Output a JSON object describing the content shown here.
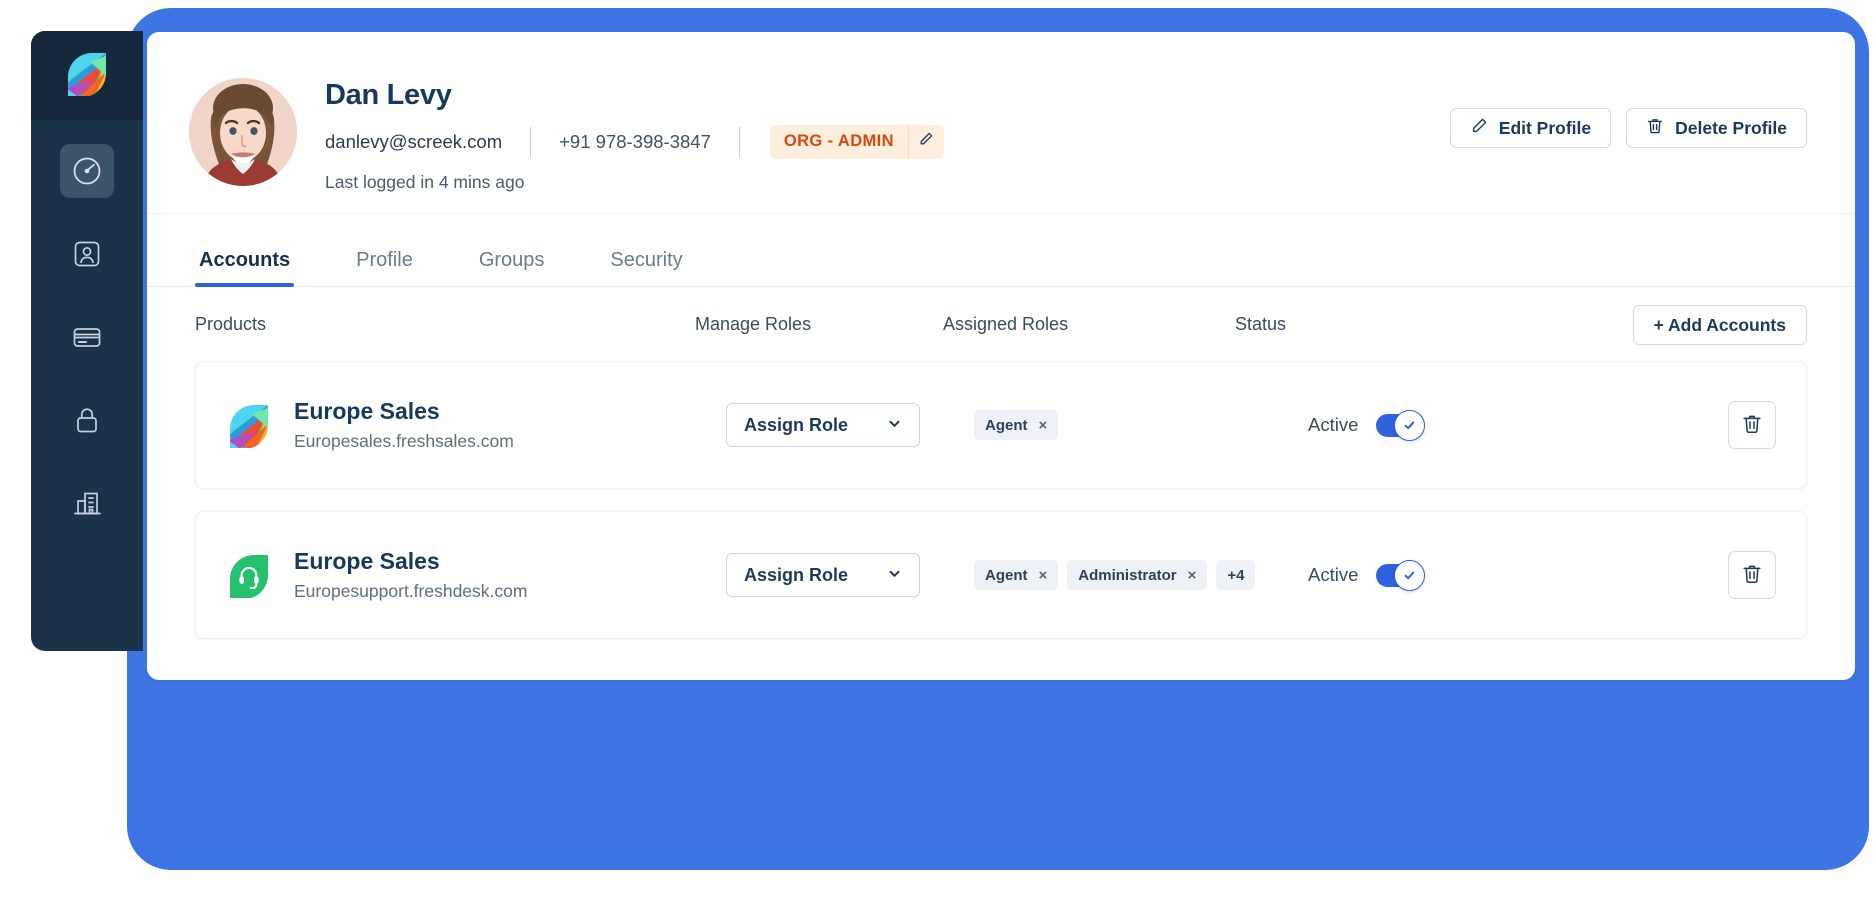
{
  "theme": {
    "frame_blue": "#3d76e4",
    "sidebar_navy": "#1b3349",
    "accent_blue": "#2f62dd",
    "badge_orange_text": "#d9480f",
    "badge_orange_bg": "#fdeedd",
    "heading_navy": "#16395c"
  },
  "sidebar": {
    "logo_icon": "freshworks-leaf-logo",
    "items": [
      {
        "icon": "gauge-dashboard-icon",
        "name": "dashboard",
        "active": true
      },
      {
        "icon": "user-card-icon",
        "name": "contacts",
        "active": false
      },
      {
        "icon": "credit-card-icon",
        "name": "billing",
        "active": false
      },
      {
        "icon": "lock-icon",
        "name": "security",
        "active": false
      },
      {
        "icon": "building-icon",
        "name": "organization",
        "active": false
      }
    ]
  },
  "profile": {
    "avatar_alt": "Dan Levy profile photo",
    "name": "Dan Levy",
    "email": "danlevy@screek.com",
    "phone": "+91 978-398-3847",
    "role_badge": "ORG - ADMIN",
    "role_badge_edit_icon": "pencil-icon",
    "last_login": "Last logged in 4 mins ago",
    "actions": [
      {
        "label": "Edit Profile",
        "icon": "pencil-icon"
      },
      {
        "label": "Delete Profile",
        "icon": "trash-icon"
      }
    ]
  },
  "tabs": [
    {
      "label": "Accounts",
      "active": true
    },
    {
      "label": "Profile",
      "active": false
    },
    {
      "label": "Groups",
      "active": false
    },
    {
      "label": "Security",
      "active": false
    }
  ],
  "table": {
    "headers": {
      "products": "Products",
      "manage_roles": "Manage Roles",
      "assigned_roles": "Assigned Roles",
      "status": "Status"
    },
    "add_accounts_label": "+ Add Accounts",
    "rows": [
      {
        "logo_icon": "freshsales-leaf-logo",
        "product_name": "Europe Sales",
        "product_url": "Europesales.freshsales.com",
        "assign_role_label": "Assign Role",
        "assign_role_chevron": "chevron-down-icon",
        "assigned_roles": [
          {
            "label": "Agent",
            "removable": true
          }
        ],
        "overflow_count": null,
        "status_label": "Active",
        "status_on": true,
        "delete_icon": "trash-icon"
      },
      {
        "logo_icon": "freshdesk-headset-logo",
        "product_name": "Europe Sales",
        "product_url": "Europesupport.freshdesk.com",
        "assign_role_label": "Assign Role",
        "assign_role_chevron": "chevron-down-icon",
        "assigned_roles": [
          {
            "label": "Agent",
            "removable": true
          },
          {
            "label": "Administrator",
            "removable": true
          }
        ],
        "overflow_count": "+4",
        "status_label": "Active",
        "status_on": true,
        "delete_icon": "trash-icon"
      }
    ]
  }
}
